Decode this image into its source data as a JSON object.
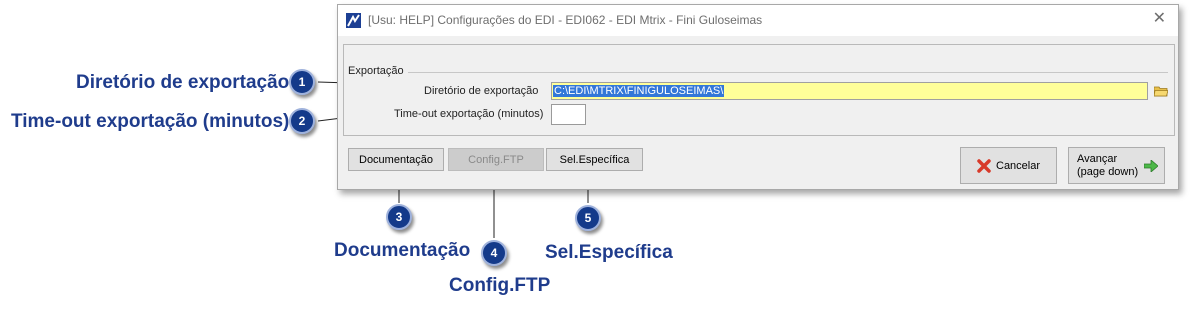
{
  "callouts": {
    "1": {
      "number": "1",
      "label": "Diretório de exportação"
    },
    "2": {
      "number": "2",
      "label": "Time-out exportação (minutos)"
    },
    "3": {
      "number": "3",
      "label": "Documentação"
    },
    "4": {
      "number": "4",
      "label": "Config.FTP"
    },
    "5": {
      "number": "5",
      "label": "Sel.Específica"
    }
  },
  "window": {
    "title": "[Usu: HELP] Configurações do EDI - EDI062 - EDI Mtrix - Fini Guloseimas",
    "close_icon": "close-icon"
  },
  "form": {
    "group_label": "Exportação",
    "export_dir_label": "Diretório  de exportação",
    "export_dir_value": "C:\\EDI\\MTRIX\\FINIGULOSEIMAS\\",
    "timeout_label": "Time-out exportação (minutos)",
    "timeout_value": ""
  },
  "buttons": {
    "documentacao": "Documentação",
    "config_ftp": "Config.FTP",
    "sel_especifica": "Sel.Específica",
    "cancelar": "Cancelar",
    "avancar_line1": "Avançar",
    "avancar_line2": "(page down)"
  },
  "colors": {
    "callout_text": "#1f3c8c",
    "badge": "#143a8a",
    "path_field_bg": "#ffff99",
    "selection": "#3377d8"
  }
}
